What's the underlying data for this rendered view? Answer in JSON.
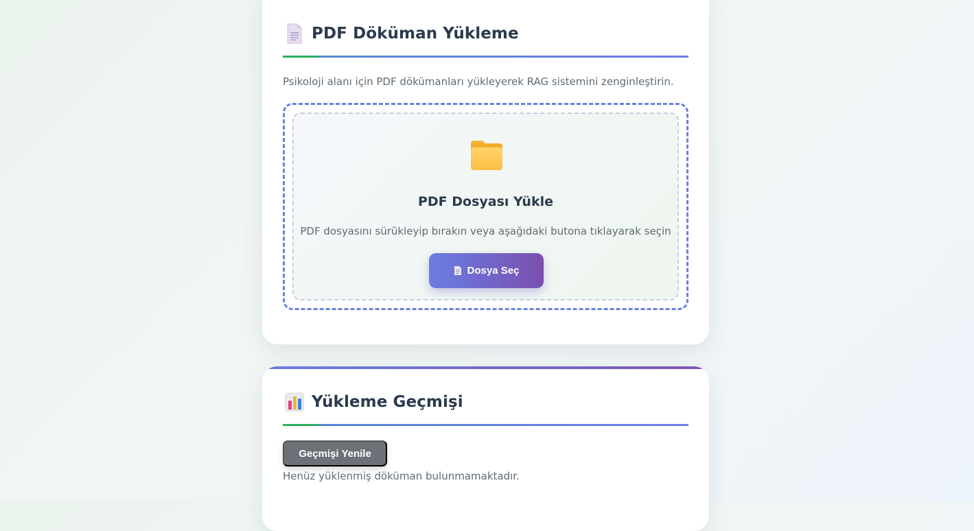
{
  "upload_card": {
    "icon": "document-icon",
    "title": "PDF Döküman Yükleme",
    "description": "Psikoloji alanı için PDF dökümanları yükleyerek RAG sistemini zenginleştirin.",
    "dropzone": {
      "icon": "folder-icon",
      "title": "PDF Dosyası Yükle",
      "instruction": "PDF dosyasını sürükleyip bırakın veya aşağıdaki butona tıklayarak seçin",
      "button_icon": "document-icon",
      "button_label": "Dosya Seç"
    }
  },
  "history_card": {
    "icon": "bar-chart-icon",
    "title": "Yükleme Geçmişi",
    "refresh_label": "Geçmişi Yenile",
    "empty_text": "Henüz yüklenmiş döküman bulunmamaktadır."
  },
  "colors": {
    "accent_blue": "#6b80e6",
    "accent_purple": "#7a4fae",
    "accent_green": "#29b05e",
    "button_gray": "#6b7177",
    "title_text": "#2b3a4d"
  }
}
